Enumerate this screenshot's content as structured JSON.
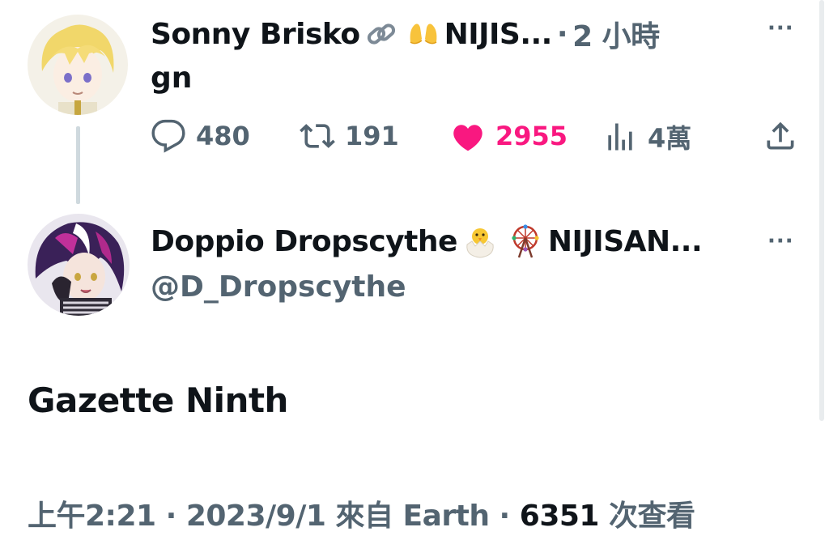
{
  "reply": {
    "display_name": "Sonny Brisko",
    "name_suffix": "NIJIS...",
    "separator": "·",
    "time_ago": "2 小時",
    "text": "gn",
    "more_label": "···",
    "emojis": [
      "link-emoji",
      "raising-hands-emoji"
    ],
    "actions": {
      "replies": "480",
      "retweets": "191",
      "likes": "2955",
      "views": "4萬"
    },
    "like_color": "#f91880"
  },
  "quoted": {
    "display_name": "Doppio Dropscythe",
    "name_suffix": "NIJISAN...",
    "handle": "@D_Dropscythe",
    "more_label": "···",
    "emojis": [
      "hatching-chick-emoji",
      "ferris-wheel-emoji"
    ],
    "body": "Gazette Ninth"
  },
  "footer": {
    "time": "上午2:21",
    "sep1": "·",
    "date": "2023/9/1",
    "source": "來自 Earth",
    "sep2": "·",
    "views_count": "6351",
    "views_label": "次查看"
  },
  "colors": {
    "text_primary": "#0f1419",
    "text_secondary": "#536471",
    "thread_line": "#cfd9de"
  }
}
